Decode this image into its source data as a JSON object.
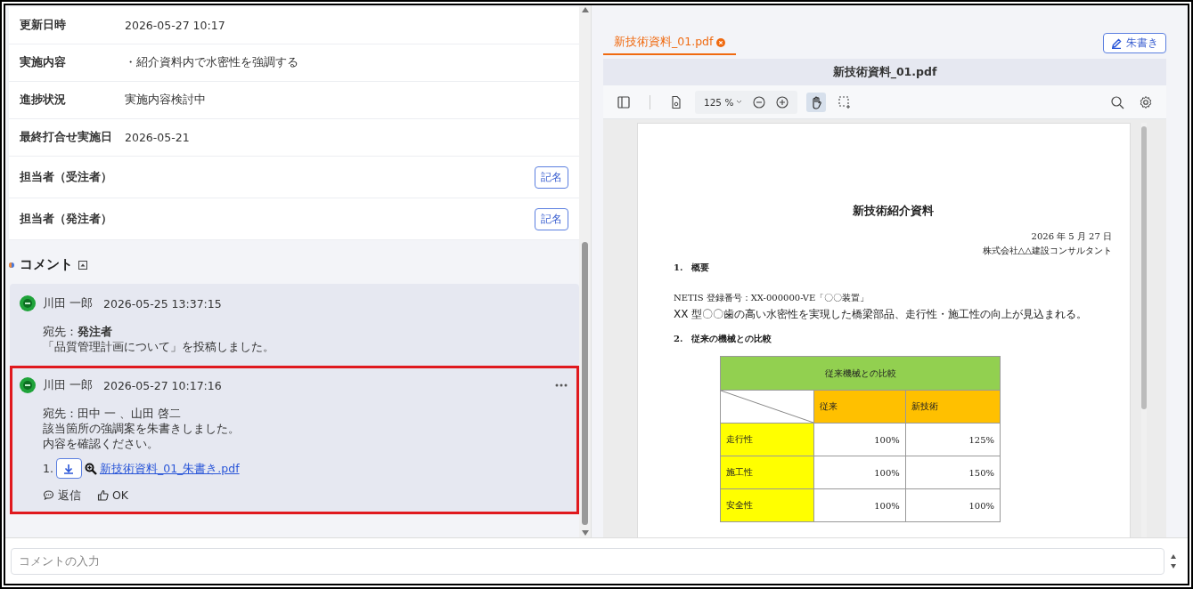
{
  "details": [
    {
      "label": "更新日時",
      "value": "2026-05-27 10:17"
    },
    {
      "label": "実施内容",
      "value": "・紹介資料内で水密性を強調する"
    },
    {
      "label": "進捗状況",
      "value": "実施内容検討中"
    },
    {
      "label": "最終打合せ実施日",
      "value": "2026-05-21"
    },
    {
      "label": "担当者（受注者）",
      "button": "記名"
    },
    {
      "label": "担当者（発注者）",
      "button": "記名"
    }
  ],
  "comments_section": {
    "title": "コメント",
    "expanded": true
  },
  "comments": [
    {
      "author": "川田 一郎",
      "time": "2026-05-25 13:37:15",
      "highlighted": false,
      "has_menu": false,
      "lines": [
        "宛先：**発注者**",
        "「品質管理計画について」を投稿しました。"
      ]
    },
    {
      "author": "川田 一郎",
      "time": "2026-05-27 10:17:16",
      "highlighted": true,
      "has_menu": true,
      "lines": [
        "宛先：田中 一 、山田 啓二",
        "該当箇所の強調案を朱書きしました。",
        "内容を確認ください。"
      ],
      "attachments": [
        {
          "index": "1.",
          "name": "新技術資料_01_朱書き.pdf"
        }
      ],
      "actions": [
        {
          "kind": "reply",
          "label": "返信"
        },
        {
          "kind": "like",
          "label": "OK"
        }
      ]
    }
  ],
  "comment_input": {
    "placeholder": "コメントの入力"
  },
  "viewer": {
    "tabs": [
      {
        "label": "新技術資料_01.pdf",
        "selected": true
      }
    ],
    "edit_button": "朱書き",
    "title": "新技術資料_01.pdf",
    "zoom": "125 %",
    "tools": [
      {
        "kind": "sidebar",
        "selected": false
      },
      {
        "kind": "document",
        "selected": false
      },
      {
        "kind": "zoom-out",
        "selected": false
      },
      {
        "kind": "zoom-in",
        "selected": false
      },
      {
        "kind": "hand",
        "selected": true
      },
      {
        "kind": "select",
        "selected": false
      },
      {
        "kind": "search",
        "selected": false
      },
      {
        "kind": "settings",
        "selected": false
      }
    ],
    "document": {
      "title": "新技術紹介資料",
      "date": "2026 年 5 月 27 日",
      "company": "株式会社△△建設コンサルタント",
      "sections": [
        {
          "heading": "1.　概要",
          "paragraphs": [
            "NETIS 登録番号：XX-000000-VE「〇〇装置」",
            "XX 型〇〇歯の高い水密性を実現した橋梁部品、走行性・施工性の向上が見込まれる。"
          ]
        },
        {
          "heading": "2.　従来の機械との比較"
        }
      ],
      "table": {
        "caption": "従来機械との比較",
        "columns": [
          "従来",
          "新技術"
        ],
        "rows": [
          {
            "label": "走行性",
            "values": [
              "100%",
              "125%"
            ]
          },
          {
            "label": "施工性",
            "values": [
              "100%",
              "150%"
            ]
          },
          {
            "label": "安全性",
            "values": [
              "100%",
              "100%"
            ]
          }
        ]
      }
    }
  }
}
